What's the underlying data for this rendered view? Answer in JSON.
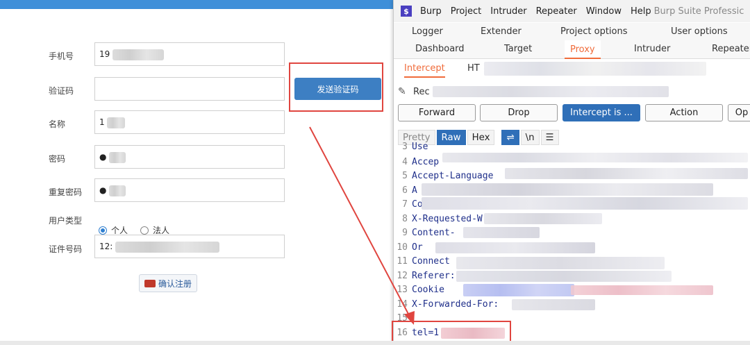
{
  "form": {
    "phone_label": "手机号",
    "phone_value": "19",
    "code_label": "验证码",
    "send_code_button": "发送验证码",
    "name_label": "名称",
    "name_value": "1",
    "password_label": "密码",
    "password_value": "●",
    "repeat_password_label": "重复密码",
    "repeat_password_value": "●",
    "user_type_label": "用户类型",
    "user_type_options": [
      "个人",
      "法人"
    ],
    "user_type_selected": "个人",
    "id_number_label": "证件号码",
    "id_number_value": "12:",
    "confirm_button": "确认注册"
  },
  "burp": {
    "logo": "$",
    "menu": [
      "Burp",
      "Project",
      "Intruder",
      "Repeater",
      "Window",
      "Help"
    ],
    "window_title": "Burp Suite Professic",
    "tabs_row1": [
      "Logger",
      "Extender",
      "Project options",
      "User options"
    ],
    "tabs_row2": [
      "Dashboard",
      "Target",
      "Proxy",
      "Intruder",
      "Repeater"
    ],
    "active_tab": "Proxy",
    "subtabs": [
      "Intercept",
      "HT"
    ],
    "active_subtab": "Intercept",
    "request_label": "Rec",
    "action_buttons": [
      "Forward",
      "Drop",
      "Intercept is ...",
      "Action",
      "Op"
    ],
    "view_buttons": [
      "Pretty",
      "Raw",
      "Hex",
      "\\n"
    ],
    "active_view": "Raw",
    "request_lines": [
      {
        "n": "3",
        "text": "Use"
      },
      {
        "n": "4",
        "text": "Accep"
      },
      {
        "n": "5",
        "text": "Accept-Language"
      },
      {
        "n": "6",
        "text": "A"
      },
      {
        "n": "7",
        "text": "Co"
      },
      {
        "n": "8",
        "text": "X-Requested-W"
      },
      {
        "n": "9",
        "text": "Content-"
      },
      {
        "n": "10",
        "text": "Or"
      },
      {
        "n": "11",
        "text": "Connect"
      },
      {
        "n": "12",
        "text": "Referer:"
      },
      {
        "n": "13",
        "text": "Cookie"
      },
      {
        "n": "14",
        "text": "X-Forwarded-For:"
      },
      {
        "n": "15",
        "text": ""
      },
      {
        "n": "16",
        "text": "tel=1"
      }
    ]
  },
  "colors": {
    "accent_orange": "#f06b3a",
    "primary_blue": "#2f6fb8",
    "highlight_red": "#e0453f"
  }
}
